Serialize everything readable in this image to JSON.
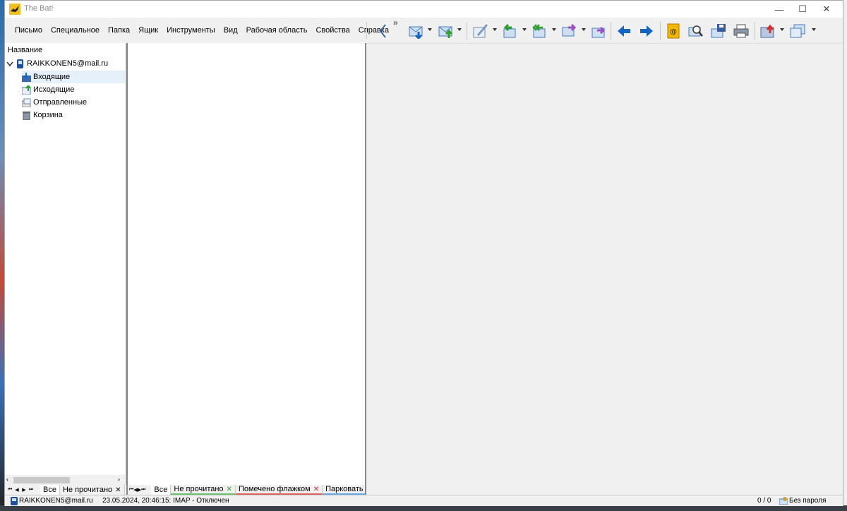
{
  "window": {
    "title": "The Bat!"
  },
  "menu": {
    "items": [
      "Письмо",
      "Специальное",
      "Папка",
      "Ящик",
      "Инструменты",
      "Вид",
      "Рабочая область",
      "Свойства",
      "Справка"
    ]
  },
  "folder_tree": {
    "header": "Название",
    "account": "RAIKKONEN5@mail.ru",
    "folders": [
      "Входящие",
      "Исходящие",
      "Отправленные",
      "Корзина"
    ]
  },
  "left_tabs": {
    "all": "Все",
    "unread": "Не прочитано"
  },
  "mid_tabs": {
    "all": "Все",
    "unread": "Не прочитано",
    "flagged": "Помечено флажком",
    "parked": "Парковать"
  },
  "status": {
    "account": "RAIKKONEN5@mail.ru",
    "log": "23.05.2024, 20:46:15: IMAP  - Отключен",
    "count": "0 / 0",
    "password": "Без пароля"
  },
  "colors": {
    "accent_blue": "#1565c0",
    "green": "#2e9e2e",
    "purple": "#9a4fc1",
    "selection": "#e5f0fb"
  }
}
